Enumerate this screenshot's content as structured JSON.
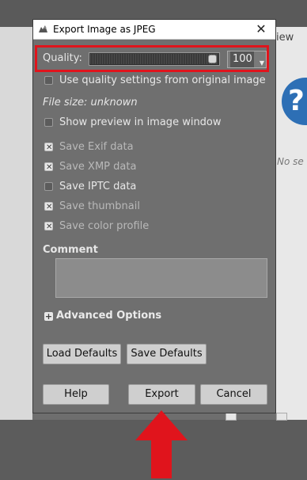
{
  "background": {
    "view_tab_label": "iew",
    "help_glyph": "?",
    "no_selection_text": "No se"
  },
  "dialog": {
    "title": "Export Image as JPEG",
    "close_glyph": "✕",
    "quality": {
      "label": "Quality:",
      "value": "100",
      "fraction": 1.0
    },
    "use_original_quality_label": "Use quality settings from original image",
    "file_size_label": "File size: unknown",
    "show_preview_label": "Show preview in image window",
    "options": [
      {
        "label": "Save Exif data",
        "checked": true
      },
      {
        "label": "Save XMP data",
        "checked": true
      },
      {
        "label": "Save IPTC data",
        "checked": false
      },
      {
        "label": "Save thumbnail",
        "checked": true
      },
      {
        "label": "Save color profile",
        "checked": true
      }
    ],
    "comment_label": "Comment",
    "advanced_label": "Advanced Options",
    "load_defaults_label": "Load Defaults",
    "save_defaults_label": "Save Defaults",
    "help_label": "Help",
    "export_label": "Export",
    "cancel_label": "Cancel"
  },
  "annotation": {
    "highlight_color": "#e0141c",
    "arrow_color": "#e0141c"
  }
}
